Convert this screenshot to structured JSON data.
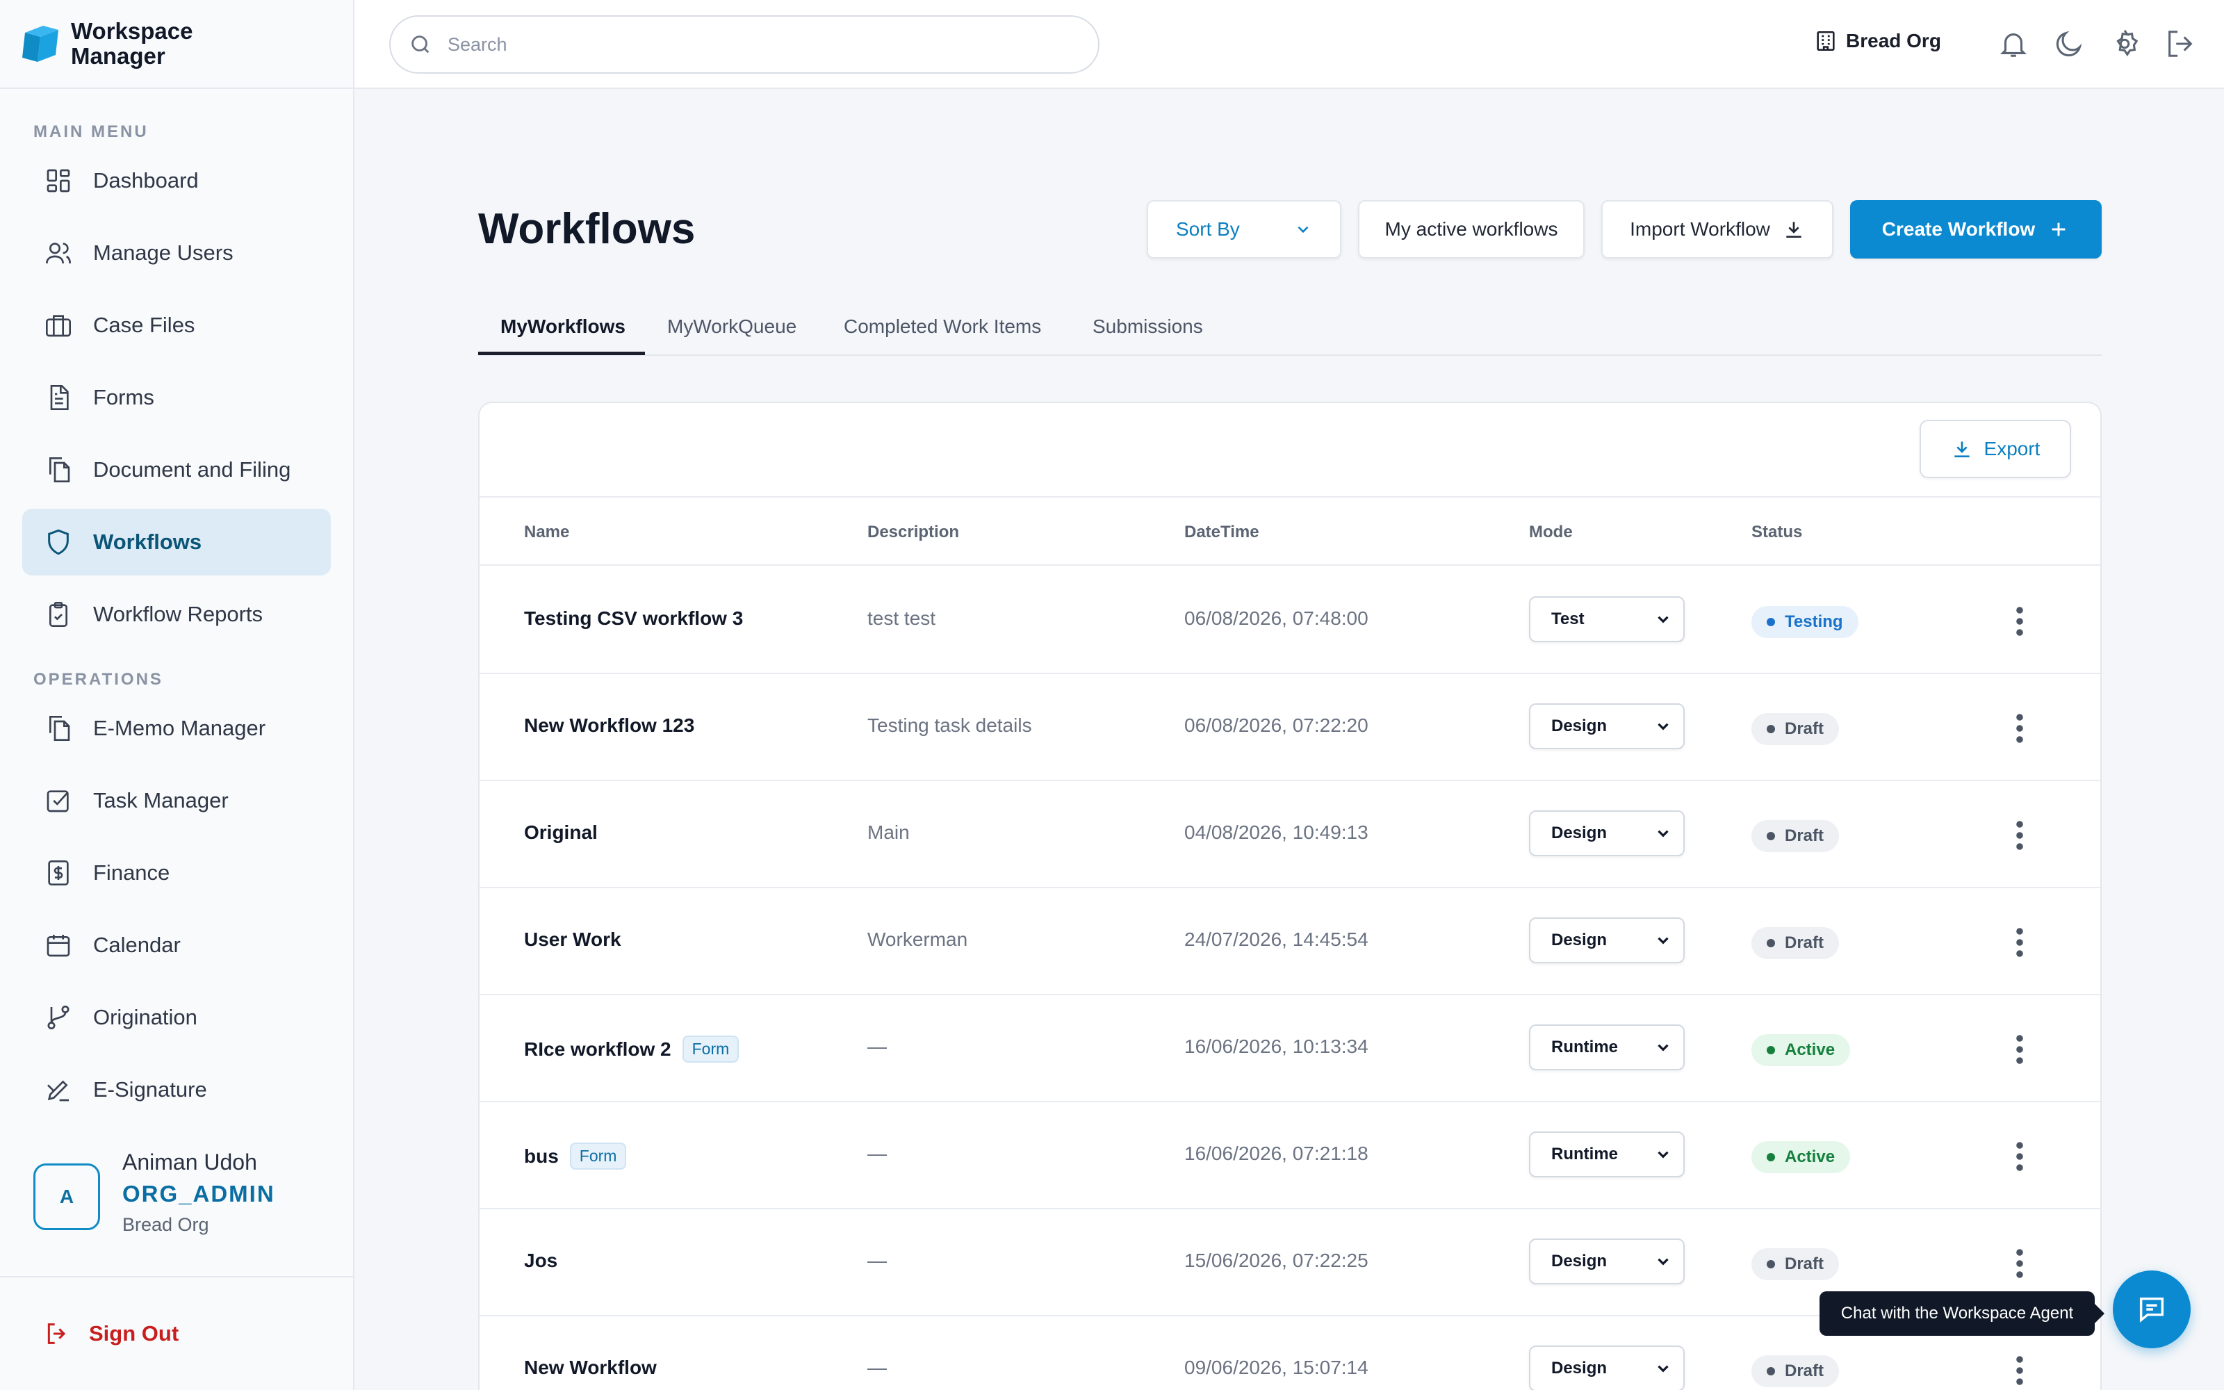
{
  "brand": {
    "line1": "Workspace",
    "line2": "Manager"
  },
  "sidebar": {
    "main_menu_label": "MAIN MENU",
    "main_items": [
      {
        "label": "Dashboard",
        "icon": "dashboard-icon"
      },
      {
        "label": "Manage Users",
        "icon": "users-icon"
      },
      {
        "label": "Case Files",
        "icon": "briefcase-icon"
      },
      {
        "label": "Forms",
        "icon": "file-text-icon"
      },
      {
        "label": "Document and Filing",
        "icon": "documents-icon"
      },
      {
        "label": "Workflows",
        "icon": "shield-icon",
        "active": true
      },
      {
        "label": "Workflow Reports",
        "icon": "clipboard-icon"
      }
    ],
    "operations_label": "OPERATIONS",
    "ops_items": [
      {
        "label": "E-Memo Manager",
        "icon": "documents-icon"
      },
      {
        "label": "Task Manager",
        "icon": "checkbox-icon"
      },
      {
        "label": "Finance",
        "icon": "dollar-icon"
      },
      {
        "label": "Calendar",
        "icon": "calendar-icon"
      },
      {
        "label": "Origination",
        "icon": "git-branch-icon"
      },
      {
        "label": "E-Signature",
        "icon": "signature-icon"
      }
    ],
    "user": {
      "initial": "A",
      "name": "Animan Udoh",
      "role": "ORG_ADMIN",
      "org": "Bread Org"
    },
    "sign_out": "Sign Out"
  },
  "topbar": {
    "search_placeholder": "Search",
    "org_name": "Bread Org",
    "icons": [
      "bell-icon",
      "moon-icon",
      "gear-icon",
      "logout-icon"
    ]
  },
  "main": {
    "title": "Workflows",
    "sort_label": "Sort By",
    "active_workflows_label": "My active workflows",
    "import_label": "Import Workflow",
    "create_label": "Create Workflow",
    "tabs": [
      "MyWorkflows",
      "MyWorkQueue",
      "Completed Work Items",
      "Submissions"
    ],
    "export_label": "Export",
    "columns": [
      "Name",
      "Description",
      "DateTime",
      "Mode",
      "Status"
    ],
    "rows": [
      {
        "name": "Testing CSV workflow 3",
        "tag": "",
        "description": "test test",
        "datetime": "06/08/2026, 07:48:00",
        "mode": "Test",
        "status": "Testing"
      },
      {
        "name": "New Workflow 123",
        "tag": "",
        "description": "Testing task details",
        "datetime": "06/08/2026, 07:22:20",
        "mode": "Design",
        "status": "Draft"
      },
      {
        "name": "Original",
        "tag": "",
        "description": "Main",
        "datetime": "04/08/2026, 10:49:13",
        "mode": "Design",
        "status": "Draft"
      },
      {
        "name": "User Work",
        "tag": "",
        "description": "Workerman",
        "datetime": "24/07/2026, 14:45:54",
        "mode": "Design",
        "status": "Draft"
      },
      {
        "name": "RIce workflow 2",
        "tag": "Form",
        "description": "—",
        "datetime": "16/06/2026, 10:13:34",
        "mode": "Runtime",
        "status": "Active"
      },
      {
        "name": "bus",
        "tag": "Form",
        "description": "—",
        "datetime": "16/06/2026, 07:21:18",
        "mode": "Runtime",
        "status": "Active"
      },
      {
        "name": "Jos",
        "tag": "",
        "description": "—",
        "datetime": "15/06/2026, 07:22:25",
        "mode": "Design",
        "status": "Draft"
      },
      {
        "name": "New Workflow",
        "tag": "",
        "description": "—",
        "datetime": "09/06/2026, 15:07:14",
        "mode": "Design",
        "status": "Draft"
      }
    ]
  },
  "chat": {
    "tooltip": "Chat with the Workspace Agent"
  },
  "colors": {
    "accent": "#0b8ad1",
    "active_bg": "#dcebf5",
    "testing_bg": "#e6f1fb",
    "testing_fg": "#1a73c9",
    "draft_bg": "#eef0f3",
    "draft_fg": "#4b5563",
    "active_status_bg": "#e4f7ea",
    "active_status_fg": "#15803d",
    "danger": "#c81e1e"
  }
}
